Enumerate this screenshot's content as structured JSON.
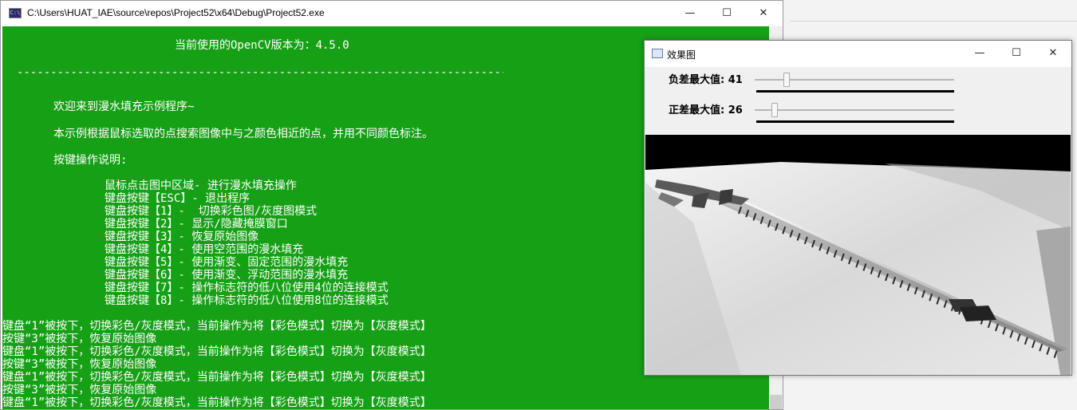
{
  "console": {
    "title": "C:\\Users\\HUAT_IAE\\source\\repos\\Project52\\x64\\Debug\\Project52.exe",
    "icon": "cmd-icon",
    "text_color": "#ffffff",
    "bg_color": "#16a016",
    "lines": [
      "当前使用的OpenCV版本为：4.5.0",
      "----------------------------------------------------------------------------",
      "欢迎来到漫水填充示例程序~",
      "本示例根据鼠标选取的点搜索图像中与之颜色相近的点，并用不同颜色标注。",
      "按键操作说明:",
      "鼠标点击图中区域- 进行漫水填充操作",
      "键盘按键【ESC】- 退出程序",
      "键盘按键【1】-  切换彩色图/灰度图模式",
      "键盘按键【2】- 显示/隐藏掩膜窗口",
      "键盘按键【3】- 恢复原始图像",
      "键盘按键【4】- 使用空范围的漫水填充",
      "键盘按键【5】- 使用渐变、固定范围的漫水填充",
      "键盘按键【6】- 使用渐变、浮动范围的漫水填充",
      "键盘按键【7】- 操作标志符的低八位使用4位的连接模式",
      "键盘按键【8】- 操作标志符的低八位使用8位的连接模式",
      "键盘“1”被按下，切换彩色/灰度模式，当前操作为将【彩色模式】切换为【灰度模式】",
      "按键“3”被按下，恢复原始图像",
      "键盘“1”被按下，切换彩色/灰度模式，当前操作为将【彩色模式】切换为【灰度模式】",
      "按键“3”被按下，恢复原始图像",
      "键盘“1”被按下，切换彩色/灰度模式，当前操作为将【彩色模式】切换为【灰度模式】",
      "按键“3”被按下，恢复原始图像",
      "键盘“1”被按下，切换彩色/灰度模式，当前操作为将【彩色模式】切换为【灰度模式】"
    ]
  },
  "effect_window": {
    "title": "效果图",
    "trackbars": [
      {
        "label": "负差最大值: 41",
        "value": 41,
        "max": 255
      },
      {
        "label": "正差最大值: 26",
        "value": 26,
        "max": 255
      }
    ]
  },
  "window_controls": {
    "minimize": "—",
    "maximize": "☐",
    "close": "✕"
  }
}
